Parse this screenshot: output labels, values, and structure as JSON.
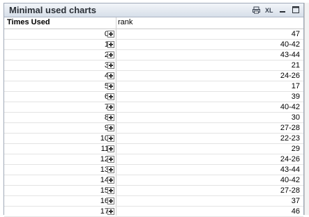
{
  "window": {
    "title": "Minimal used charts"
  },
  "titlebar_icons": [
    "print-icon",
    "xl-export-icon",
    "minimize-icon",
    "maximize-icon"
  ],
  "table": {
    "columns": [
      "Times Used",
      "rank"
    ],
    "rows": [
      {
        "times": "0",
        "rank": "47"
      },
      {
        "times": "1",
        "rank": "40-42"
      },
      {
        "times": "2",
        "rank": "43-44"
      },
      {
        "times": "3",
        "rank": "21"
      },
      {
        "times": "4",
        "rank": "24-26"
      },
      {
        "times": "5",
        "rank": "17"
      },
      {
        "times": "6",
        "rank": "39"
      },
      {
        "times": "7",
        "rank": "40-42"
      },
      {
        "times": "8",
        "rank": "30"
      },
      {
        "times": "9",
        "rank": "27-28"
      },
      {
        "times": "10",
        "rank": "22-23"
      },
      {
        "times": "11",
        "rank": "29"
      },
      {
        "times": "12",
        "rank": "24-26"
      },
      {
        "times": "13",
        "rank": "43-44"
      },
      {
        "times": "14",
        "rank": "40-42"
      },
      {
        "times": "15",
        "rank": "27-28"
      },
      {
        "times": "16",
        "rank": "37"
      },
      {
        "times": "17",
        "rank": "46"
      }
    ]
  }
}
